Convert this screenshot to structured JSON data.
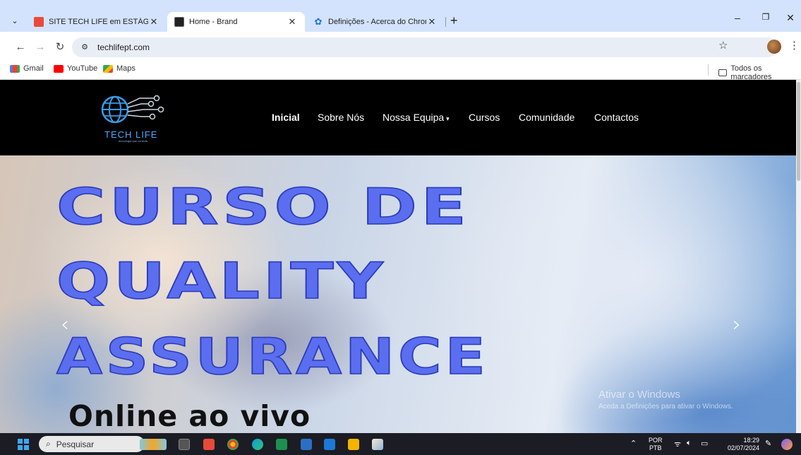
{
  "browser": {
    "tabs": [
      {
        "title": "SITE TECH LIFE em ESTÁGIO TU",
        "favicon": "techlife-favicon",
        "active": false
      },
      {
        "title": "Home - Brand",
        "favicon": "brand-favicon",
        "active": true
      },
      {
        "title": "Definições - Acerca do Chrome",
        "favicon": "settings-gear-icon",
        "active": false
      }
    ],
    "close_glyph": "✕",
    "new_tab_glyph": "+",
    "url": "techlifept.com",
    "bookmarks": [
      {
        "label": "Gmail",
        "icon": "gmail-icon"
      },
      {
        "label": "YouTube",
        "icon": "youtube-icon"
      },
      {
        "label": "Maps",
        "icon": "maps-icon"
      }
    ],
    "all_bookmarks_label": "Todos os marcadores"
  },
  "site": {
    "logo_text": "TECH LIFE",
    "logo_tagline": "tecnologia que conecta",
    "nav": [
      {
        "label": "Inicial",
        "active": true,
        "dropdown": false
      },
      {
        "label": "Sobre Nós",
        "active": false,
        "dropdown": false
      },
      {
        "label": "Nossa Equipa",
        "active": false,
        "dropdown": true
      },
      {
        "label": "Cursos",
        "active": false,
        "dropdown": false
      },
      {
        "label": "Comunidade",
        "active": false,
        "dropdown": false
      },
      {
        "label": "Contactos",
        "active": false,
        "dropdown": false
      }
    ],
    "hero": {
      "title_lines": [
        "CURSO DE",
        "QUALITY",
        "ASSURANCE"
      ],
      "subtitle": "Online ao vivo",
      "prev_glyph": "‹",
      "next_glyph": "›"
    },
    "watermark": {
      "line1": "Ativar o Windows",
      "line2": "Aceda a Definições para ativar o Windows."
    }
  },
  "taskbar": {
    "search_placeholder": "Pesquisar",
    "lang_top": "POR",
    "lang_bottom": "PTB",
    "time": "18:29",
    "date": "02/07/2024"
  },
  "colors": {
    "tabstrip": "#d3e3fd",
    "site_header": "#000000",
    "hero_text": "#5b6ef0",
    "taskbar": "#1c1c24"
  }
}
